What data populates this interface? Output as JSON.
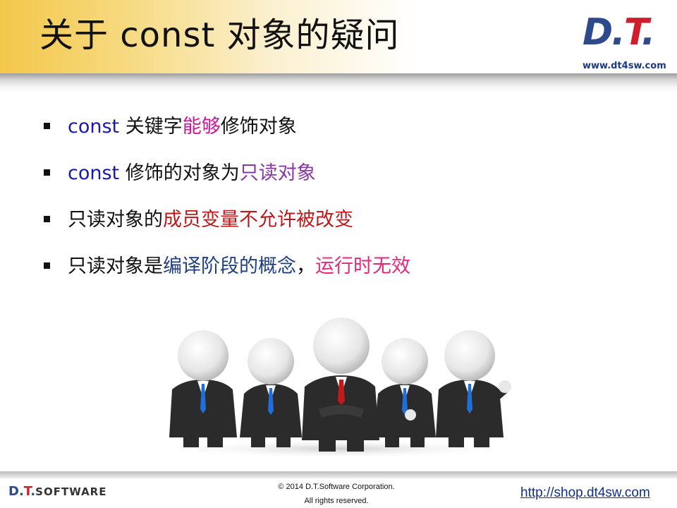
{
  "slide": {
    "title": "关于 const 对象的疑问"
  },
  "logo": {
    "letters": "D.",
    "letters_red": "T",
    "dot": ".",
    "url": "www.dt4sw.com"
  },
  "bullets": [
    {
      "segments": [
        {
          "text": "const",
          "color": "blue"
        },
        {
          "text": " 关键字",
          "color": "black"
        },
        {
          "text": "能够",
          "color": "magenta"
        },
        {
          "text": "修饰对象",
          "color": "black"
        }
      ]
    },
    {
      "segments": [
        {
          "text": "const",
          "color": "blue"
        },
        {
          "text": " 修饰的对象为",
          "color": "black"
        },
        {
          "text": "只读对象",
          "color": "purple"
        }
      ]
    },
    {
      "segments": [
        {
          "text": "只读对象的",
          "color": "black"
        },
        {
          "text": "成员变量",
          "color": "red"
        },
        {
          "text": "不允许被改变",
          "color": "red"
        }
      ]
    },
    {
      "segments": [
        {
          "text": "只读对象是",
          "color": "black"
        },
        {
          "text": "编译阶段的概念",
          "color": "darkblue"
        },
        {
          "text": "，",
          "color": "black"
        },
        {
          "text": "运行时无效",
          "color": "pink"
        }
      ]
    }
  ],
  "footer": {
    "logo_letters": "D.",
    "logo_letters_red": "T",
    "logo_dot": ".",
    "logo_word": "SOFTWARE",
    "copyright_line1": "© 2014 D.T.Software Corporation.",
    "copyright_line2": "All rights reserved.",
    "link": "http://shop.dt4sw.com"
  },
  "colors": {
    "blue": "#1a1aa8",
    "magenta": "#d1149a",
    "purple": "#8a38a8",
    "red": "#c01818",
    "darkblue": "#1f3f85",
    "pink": "#e5287a",
    "black": "#111111",
    "header_gold": "#f3c74a",
    "logo_blue": "#2d4a8c",
    "logo_red": "#cf1f2e",
    "suit": "#2b2b2b",
    "tie_blue": "#1f6fd6",
    "tie_red": "#c21a1a"
  },
  "illustration": {
    "icon": "business-figures-icon"
  }
}
